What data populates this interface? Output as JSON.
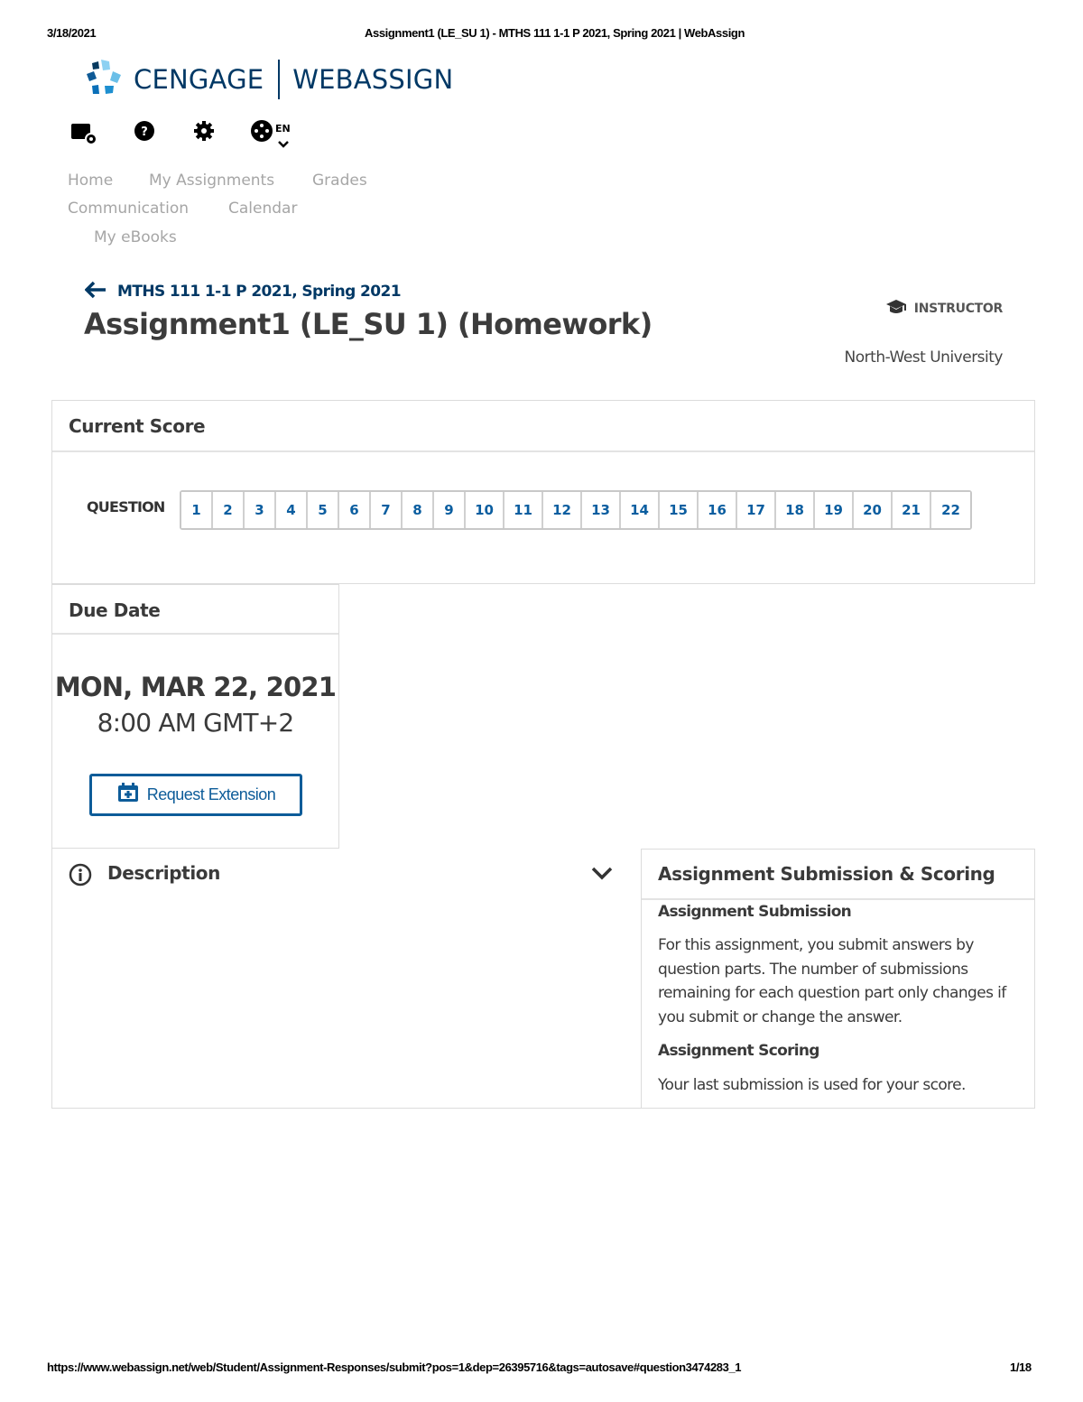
{
  "print_header": {
    "date": "3/18/2021",
    "title": "Assignment1 (LE_SU 1) - MTHS 111 1-1 P 2021, Spring 2021 | WebAssign"
  },
  "print_footer": {
    "url": "https://www.webassign.net/web/Student/Assignment-Responses/submit?pos=1&dep=26395716&tags=autosave#question3474283_1",
    "page": "1/18"
  },
  "brand": {
    "cengage": "CENGAGE",
    "webassign": "WEBASSIGN",
    "color": "#003865"
  },
  "toolbar": {
    "icons": [
      "course-packs-icon",
      "help-icon",
      "settings-icon",
      "language-globe-icon"
    ],
    "language": "EN"
  },
  "nav": {
    "items": [
      {
        "label": "Home"
      },
      {
        "label": "My Assignments"
      },
      {
        "label": "Grades"
      },
      {
        "label": "Communication"
      },
      {
        "label": "Calendar"
      },
      {
        "label": "My eBooks"
      }
    ]
  },
  "breadcrumb": {
    "label": "MTHS 111 1-1 P 2021, Spring 2021"
  },
  "page": {
    "title": "Assignment1 (LE_SU 1) (Homework)",
    "role": "INSTRUCTOR",
    "institution": "North-West University"
  },
  "score": {
    "title": "Current Score",
    "question_label": "QUESTION",
    "questions": [
      "1",
      "2",
      "3",
      "4",
      "5",
      "6",
      "7",
      "8",
      "9",
      "10",
      "11",
      "12",
      "13",
      "14",
      "15",
      "16",
      "17",
      "18",
      "19",
      "20",
      "21",
      "22"
    ],
    "link_color": "#0b5ea0"
  },
  "due": {
    "title": "Due Date",
    "date": "MON, MAR 22, 2021",
    "time": "8:00 AM GMT+2",
    "extension_button": "Request Extension"
  },
  "description": {
    "title": "Description"
  },
  "submission": {
    "title": "Assignment Submission & Scoring",
    "submission_heading": "Assignment Submission",
    "submission_text": "For this assignment, you submit answers by question parts. The number of submissions remaining for each question part only changes if you submit or change the answer.",
    "scoring_heading": "Assignment Scoring",
    "scoring_text": "Your last submission is used for your score."
  }
}
